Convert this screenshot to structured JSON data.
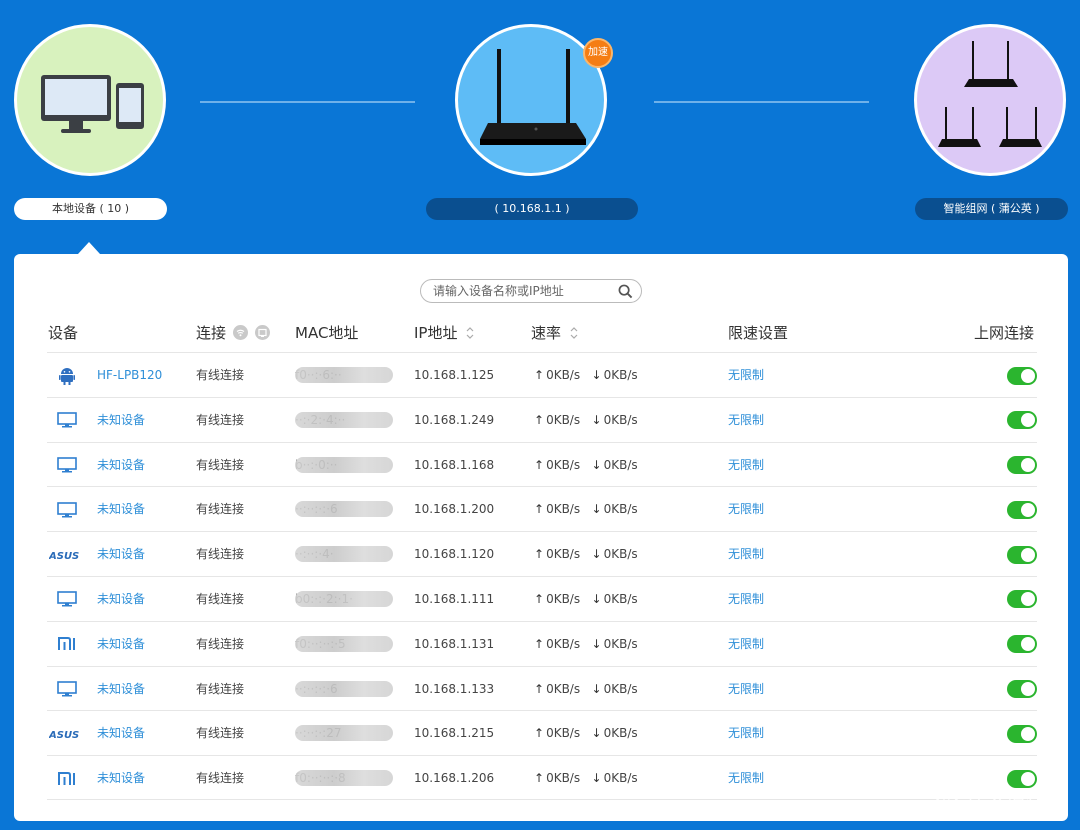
{
  "topology": {
    "local": {
      "label": "本地设备 ( 10 )"
    },
    "router": {
      "label": "( 10.168.1.1 )",
      "badge": "加速"
    },
    "mesh": {
      "label": "智能组网 ( 蒲公英 )"
    }
  },
  "search": {
    "placeholder": "请输入设备名称或IP地址"
  },
  "table": {
    "headers": {
      "device": "设备",
      "connection": "连接",
      "mac": "MAC地址",
      "ip": "IP地址",
      "speed": "速率",
      "limit": "限速设置",
      "online": "上网连接"
    },
    "rows": [
      {
        "icon": "android-icon",
        "name": "HF-LPB120",
        "connection": "有线连接",
        "mac": "f0··:·6:··",
        "ip": "10.168.1.125",
        "up": "0KB/s",
        "down": "0KB/s",
        "limit": "无限制",
        "online": true
      },
      {
        "icon": "monitor-icon",
        "name": "未知设备",
        "connection": "有线连接",
        "mac": "··:·2:·4:··",
        "ip": "10.168.1.249",
        "up": "0KB/s",
        "down": "0KB/s",
        "limit": "无限制",
        "online": true
      },
      {
        "icon": "monitor-icon",
        "name": "未知设备",
        "connection": "有线连接",
        "mac": "b··:·0:··",
        "ip": "10.168.1.168",
        "up": "0KB/s",
        "down": "0KB/s",
        "limit": "无限制",
        "online": true
      },
      {
        "icon": "monitor-icon",
        "name": "未知设备",
        "connection": "有线连接",
        "mac": "··:··:·:·6",
        "ip": "10.168.1.200",
        "up": "0KB/s",
        "down": "0KB/s",
        "limit": "无限制",
        "online": true
      },
      {
        "icon": "asus-icon",
        "name": "未知设备",
        "connection": "有线连接",
        "mac": "··:··:·4·",
        "ip": "10.168.1.120",
        "up": "0KB/s",
        "down": "0KB/s",
        "limit": "无限制",
        "online": true
      },
      {
        "icon": "monitor-icon",
        "name": "未知设备",
        "connection": "有线连接",
        "mac": "b0:·:·2:·1·",
        "ip": "10.168.1.111",
        "up": "0KB/s",
        "down": "0KB/s",
        "limit": "无限制",
        "online": true
      },
      {
        "icon": "mi-icon",
        "name": "未知设备",
        "connection": "有线连接",
        "mac": "f0:··:··:·5",
        "ip": "10.168.1.131",
        "up": "0KB/s",
        "down": "0KB/s",
        "limit": "无限制",
        "online": true
      },
      {
        "icon": "monitor-icon",
        "name": "未知设备",
        "connection": "有线连接",
        "mac": "··:··:·:·6",
        "ip": "10.168.1.133",
        "up": "0KB/s",
        "down": "0KB/s",
        "limit": "无限制",
        "online": true
      },
      {
        "icon": "asus-icon",
        "name": "未知设备",
        "connection": "有线连接",
        "mac": "··:··:·:27",
        "ip": "10.168.1.215",
        "up": "0KB/s",
        "down": "0KB/s",
        "limit": "无限制",
        "online": true
      },
      {
        "icon": "mi-icon",
        "name": "未知设备",
        "connection": "有线连接",
        "mac": "f0:··:··:·8",
        "ip": "10.168.1.206",
        "up": "0KB/s",
        "down": "0KB/s",
        "limit": "无限制",
        "online": true
      }
    ]
  },
  "watermark": {
    "text": "什么值得买",
    "icon_label": "值"
  },
  "colors": {
    "background": "#0a76d6",
    "link": "#2f8fd8",
    "toggle_on": "#2bb52f",
    "badge": "#f57d13"
  }
}
